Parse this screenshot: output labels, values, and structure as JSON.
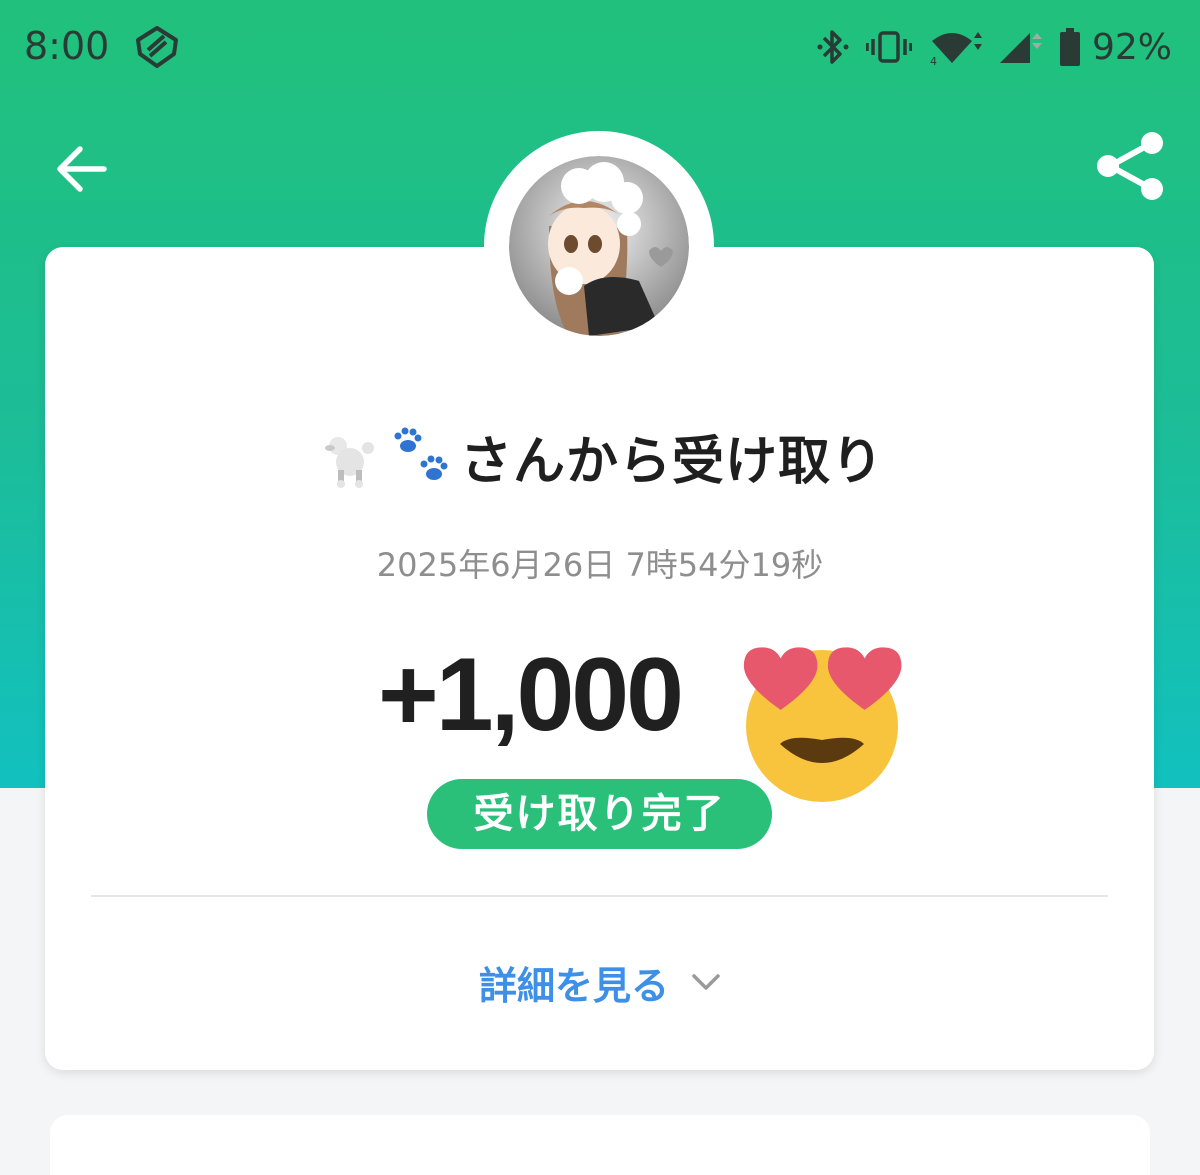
{
  "status_bar": {
    "time": "8:00",
    "app_icon": "mobile-app-icon",
    "icons": [
      "bluetooth-icon",
      "vibrate-icon",
      "wifi-icon",
      "signal-icon",
      "battery-icon"
    ],
    "battery_text": "92%"
  },
  "header": {
    "back_icon": "arrow-left-icon",
    "share_icon": "share-icon"
  },
  "transaction": {
    "sender_avatar": "sender-avatar",
    "sender_icons": [
      "poodle-emoji",
      "paw-prints-emoji"
    ],
    "title": "さんから受け取り",
    "timestamp": "2025年6月26日 7時54分19秒",
    "amount": "+1,000",
    "reaction_icon": "heart-eyes-emoji",
    "status": "受け取り完了",
    "details_label": "詳細を見る",
    "details_icon": "chevron-down-icon"
  },
  "colors": {
    "header_top": "#21c07b",
    "header_bottom": "#12c1bf",
    "badge": "#2ac07a",
    "link": "#3d8fe8",
    "amount": "#202020",
    "timestamp": "#8e8e8e"
  }
}
